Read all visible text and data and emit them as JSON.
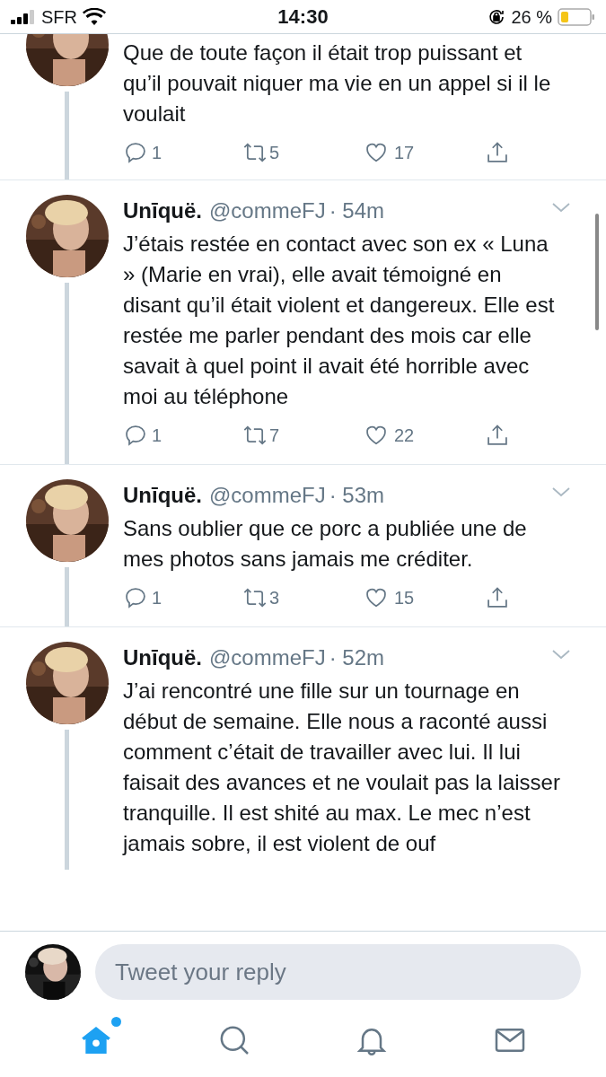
{
  "status_bar": {
    "carrier": "SFR",
    "time": "14:30",
    "battery": "26 %"
  },
  "tweets": [
    {
      "text": "Que de toute façon il était trop puissant et qu’il pouvait niquer ma vie en un appel si il le voulait",
      "replies": "1",
      "retweets": "5",
      "likes": "17"
    },
    {
      "name": "Unīquë.",
      "handle": "@commeFJ",
      "time": "· 54m",
      "text": "J’étais restée en contact avec son ex « Luna » (Marie en vrai), elle avait témoigné en disant qu’il était violent et dangereux. Elle est restée me parler pendant des mois car elle savait à quel point il avait été horrible avec moi au téléphone",
      "replies": "1",
      "retweets": "7",
      "likes": "22"
    },
    {
      "name": "Unīquë.",
      "handle": "@commeFJ",
      "time": "· 53m",
      "text": "Sans oublier que ce porc a publiée une de mes photos sans jamais me créditer.",
      "replies": "1",
      "retweets": "3",
      "likes": "15"
    },
    {
      "name": "Unīquë.",
      "handle": "@commeFJ",
      "time": "· 52m",
      "text": "J’ai rencontré une fille sur un tournage en début de semaine. Elle nous a raconté aussi comment c’était de travailler avec lui. Il lui faisait des avances et ne voulait pas la laisser tranquille. Il est shité au max. Le mec n’est jamais sobre, il est violent de ouf"
    }
  ],
  "reply_field": {
    "placeholder": "Tweet your reply"
  },
  "tab_bar": [
    {
      "kind": "home",
      "selected": true,
      "badge": true
    },
    {
      "kind": "search",
      "selected": false,
      "badge": false
    },
    {
      "kind": "notifications",
      "selected": false,
      "badge": false
    },
    {
      "kind": "messages",
      "selected": false,
      "badge": false
    }
  ]
}
